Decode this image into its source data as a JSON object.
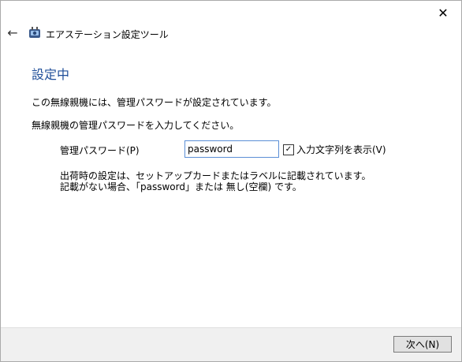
{
  "window": {
    "title": "エアステーション設定ツール",
    "close_glyph": "✕",
    "back_glyph": "←"
  },
  "page": {
    "heading": "設定中",
    "message1": "この無線親機には、管理パスワードが設定されています。",
    "message2": "無線親機の管理パスワードを入力してください。"
  },
  "form": {
    "password_label": "管理パスワード(P)",
    "password_value": "password",
    "show_chars_label": "入力文字列を表示(V)",
    "show_chars_checked": true
  },
  "notes": {
    "line1": "出荷時の設定は、セットアップカードまたはラベルに記載されています。",
    "line2": "記載がない場合、「password」または 無し(空欄) です。"
  },
  "footer": {
    "next_label": "次へ(N)"
  },
  "colors": {
    "heading": "#1f4e99",
    "input_border": "#5b8fd6",
    "footer_bg": "#f0f0f0"
  }
}
